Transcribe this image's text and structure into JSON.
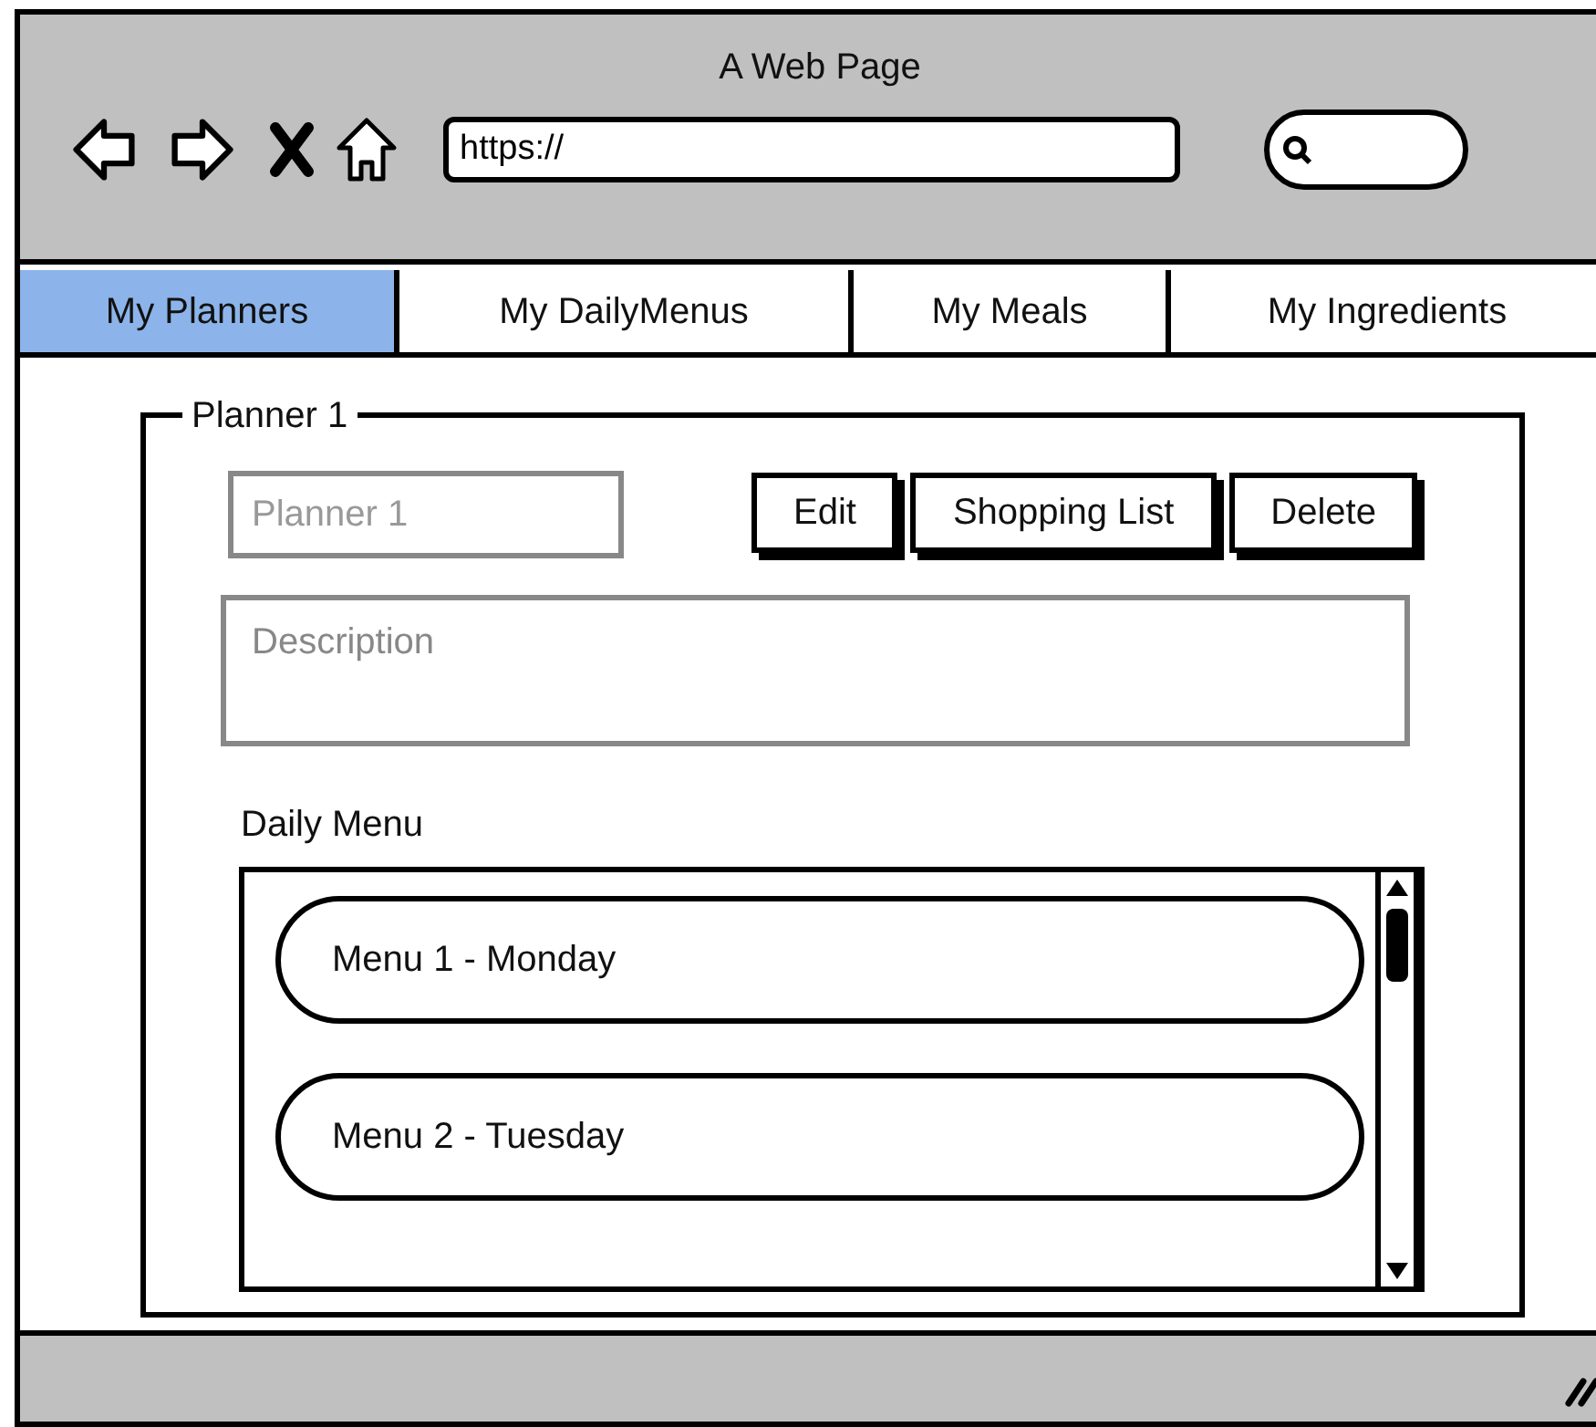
{
  "window": {
    "title": "A Web Page"
  },
  "address_bar": {
    "value": "https://"
  },
  "tabs": [
    {
      "label": "My Planners",
      "selected": true
    },
    {
      "label": "My DailyMenus",
      "selected": false
    },
    {
      "label": "My Meals",
      "selected": false
    },
    {
      "label": "My Ingredients",
      "selected": false
    }
  ],
  "planner": {
    "legend": "Planner 1",
    "name_placeholder": "Planner 1",
    "description_placeholder": "Description",
    "buttons": [
      "Edit",
      "Shopping List",
      "Delete"
    ],
    "list_label": "Daily Menu",
    "menus": [
      "Menu 1 - Monday",
      "Menu 2 - Tuesday"
    ]
  }
}
